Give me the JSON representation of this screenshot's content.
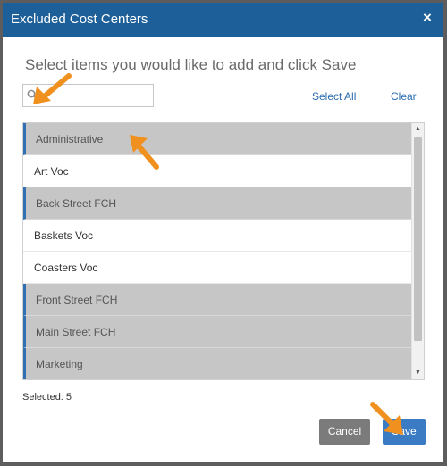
{
  "dialog": {
    "title": "Excluded Cost Centers",
    "close_label": "×",
    "subtitle": "Select items you would like to add and click Save"
  },
  "search": {
    "value": "",
    "placeholder": "",
    "icon": "search-icon"
  },
  "actions": {
    "select_all": "Select All",
    "clear": "Clear"
  },
  "list": {
    "items": [
      {
        "label": "Administrative",
        "selected": true
      },
      {
        "label": "Art Voc",
        "selected": false
      },
      {
        "label": "Back Street FCH",
        "selected": true
      },
      {
        "label": "Baskets Voc",
        "selected": false
      },
      {
        "label": "Coasters Voc",
        "selected": false
      },
      {
        "label": "Front Street FCH",
        "selected": true
      },
      {
        "label": "Main Street FCH",
        "selected": true
      },
      {
        "label": "Marketing",
        "selected": true
      }
    ]
  },
  "footer": {
    "selected_text": "Selected: 5",
    "cancel_label": "Cancel",
    "save_label": "Save"
  },
  "colors": {
    "header": "#1d5f98",
    "selected_row": "#c6c6c6",
    "accent_border": "#2f6fb2",
    "save_button": "#3a7bc4",
    "cancel_button": "#7b7b7b",
    "annotation_arrow": "#f0901e"
  }
}
